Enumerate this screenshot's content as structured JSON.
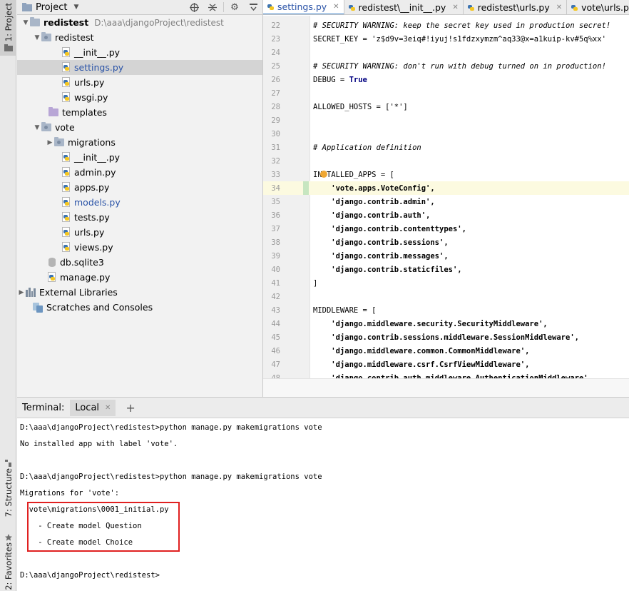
{
  "tool_strip": {
    "project_label": "1: Project",
    "structure_label": "7: Structure",
    "favorites_label": "2: Favorites"
  },
  "project_panel": {
    "title": "Project",
    "tree": [
      {
        "label": "redistest",
        "path": "D:\\aaa\\djangoProject\\redistest"
      },
      {
        "label": "redistest"
      },
      {
        "label": "__init__.py"
      },
      {
        "label": "settings.py"
      },
      {
        "label": "urls.py"
      },
      {
        "label": "wsgi.py"
      },
      {
        "label": "templates"
      },
      {
        "label": "vote"
      },
      {
        "label": "migrations"
      },
      {
        "label": "__init__.py"
      },
      {
        "label": "admin.py"
      },
      {
        "label": "apps.py"
      },
      {
        "label": "models.py"
      },
      {
        "label": "tests.py"
      },
      {
        "label": "urls.py"
      },
      {
        "label": "views.py"
      },
      {
        "label": "db.sqlite3"
      },
      {
        "label": "manage.py"
      },
      {
        "label": "External Libraries"
      },
      {
        "label": "Scratches and Consoles"
      }
    ]
  },
  "editor": {
    "tabs": [
      {
        "label": "settings.py"
      },
      {
        "label": "redistest\\__init__.py"
      },
      {
        "label": "redistest\\urls.py"
      },
      {
        "label": "vote\\urls.py"
      }
    ],
    "lines": [
      {
        "n": "22",
        "text": "# SECURITY WARNING: keep the secret key used in production secret!"
      },
      {
        "n": "23",
        "text": "SECRET_KEY = 'z$d9v=3eiq#!iyuj!s1fdzxymzm^aq33@x=a1kuip-kv#5q%xx'"
      },
      {
        "n": "24",
        "text": ""
      },
      {
        "n": "25",
        "text": "# SECURITY WARNING: don't run with debug turned on in production!"
      },
      {
        "n": "26",
        "text": "DEBUG = True"
      },
      {
        "n": "27",
        "text": ""
      },
      {
        "n": "28",
        "text": "ALLOWED_HOSTS = ['*']"
      },
      {
        "n": "29",
        "text": ""
      },
      {
        "n": "30",
        "text": ""
      },
      {
        "n": "31",
        "text": "# Application definition"
      },
      {
        "n": "32",
        "text": ""
      },
      {
        "n": "33",
        "text": "INSTALLED_APPS = ["
      },
      {
        "n": "34",
        "text": "    'vote.apps.VoteConfig',"
      },
      {
        "n": "35",
        "text": "    'django.contrib.admin',"
      },
      {
        "n": "36",
        "text": "    'django.contrib.auth',"
      },
      {
        "n": "37",
        "text": "    'django.contrib.contenttypes',"
      },
      {
        "n": "38",
        "text": "    'django.contrib.sessions',"
      },
      {
        "n": "39",
        "text": "    'django.contrib.messages',"
      },
      {
        "n": "40",
        "text": "    'django.contrib.staticfiles',"
      },
      {
        "n": "41",
        "text": "]"
      },
      {
        "n": "42",
        "text": ""
      },
      {
        "n": "43",
        "text": "MIDDLEWARE = ["
      },
      {
        "n": "44",
        "text": "    'django.middleware.security.SecurityMiddleware',"
      },
      {
        "n": "45",
        "text": "    'django.contrib.sessions.middleware.SessionMiddleware',"
      },
      {
        "n": "46",
        "text": "    'django.middleware.common.CommonMiddleware',"
      },
      {
        "n": "47",
        "text": "    'django.middleware.csrf.CsrfViewMiddleware',"
      },
      {
        "n": "48",
        "text": "    'django.contrib.auth.middleware.AuthenticationMiddleware',"
      }
    ]
  },
  "terminal": {
    "title": "Terminal:",
    "tab_label": "Local",
    "lines": [
      "D:\\aaa\\djangoProject\\redistest>python manage.py makemigrations vote",
      "No installed app with label 'vote'.",
      "",
      "D:\\aaa\\djangoProject\\redistest>python manage.py makemigrations vote",
      "Migrations for 'vote':",
      "  vote\\migrations\\0001_initial.py",
      "    - Create model Question",
      "    - Create model Choice",
      "",
      "D:\\aaa\\djangoProject\\redistest>"
    ]
  },
  "colors": {
    "accent_blue": "#2a53a7",
    "highlight_box": "#e02020",
    "string_green": "#067d17"
  }
}
